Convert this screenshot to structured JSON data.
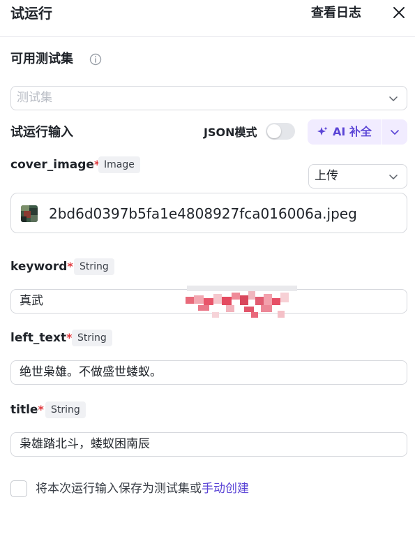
{
  "header": {
    "title": "试运行",
    "view_log": "查看日志"
  },
  "testset": {
    "label": "可用测试集",
    "placeholder": "测试集"
  },
  "run_input": {
    "label": "试运行输入",
    "json_mode_label": "JSON模式",
    "json_mode_on": false,
    "ai_fill_label": "AI 补全"
  },
  "params": [
    {
      "name": "cover_image",
      "required": "*",
      "type": "Image",
      "upload_mode": "上传",
      "file_name": "2bd6d0397b5fa1e4808927fca016006a.jpeg"
    },
    {
      "name": "keyword",
      "required": "*",
      "type": "String",
      "value": "真武"
    },
    {
      "name": "left_text",
      "required": "*",
      "type": "String",
      "value": "绝世枭雄。不做盛世蝼蚁。"
    },
    {
      "name": "title",
      "required": "*",
      "type": "String",
      "value": "枭雄踏北斗，蝼蚁困南辰"
    }
  ],
  "footer": {
    "save_prefix": "将本次运行输入保存为测试集或",
    "save_link": "手动创建",
    "checked": false
  },
  "colors": {
    "accent": "#5b45d6",
    "required": "#e0393e",
    "ai_bg": "#f1ecff"
  }
}
